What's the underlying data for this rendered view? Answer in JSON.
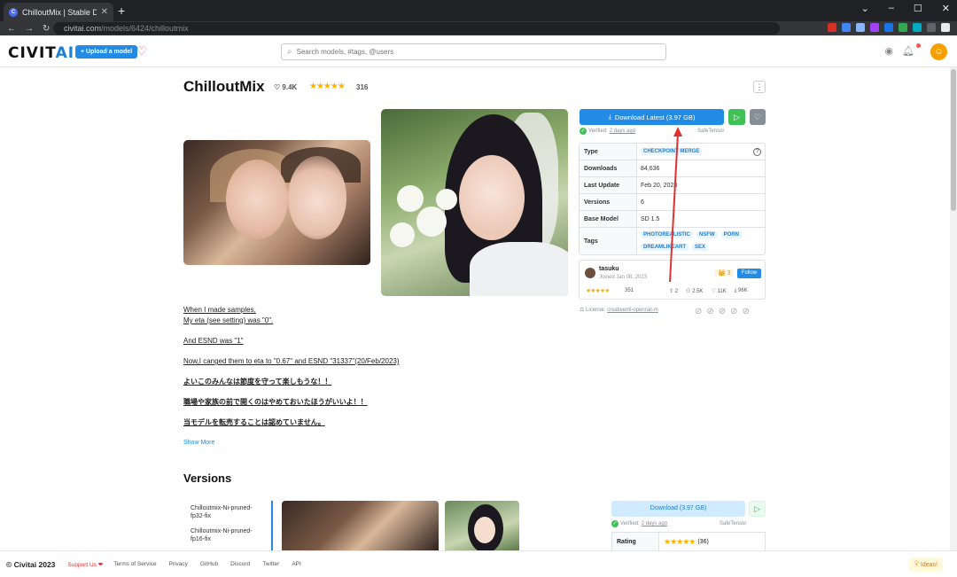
{
  "browser": {
    "tab_title": "ChilloutMix | Stable Diffusion C",
    "favicon_letter": "C",
    "url_host": "civitai.com",
    "url_path": "/models/6424/chilloutmix"
  },
  "header": {
    "logo_main": "CIVIT",
    "logo_accent": "AI",
    "upload_label": "+ Upload a model",
    "search_placeholder": "Search models, #tags, @users"
  },
  "model": {
    "title": "ChilloutMix",
    "likes": "9.4K",
    "stars": "★★★★★",
    "rating_count": "316"
  },
  "download": {
    "label": "Download Latest (3.97 GB)",
    "verified_prefix": "Verified:",
    "verified_time": "2 days ago",
    "format": "SafeTensor"
  },
  "details": {
    "rows": [
      {
        "k": "Type",
        "v": "",
        "badges": [
          "CHECKPOINT MERGE"
        ]
      },
      {
        "k": "Downloads",
        "v": "84,636"
      },
      {
        "k": "Last Update",
        "v": "Feb 20, 2023"
      },
      {
        "k": "Versions",
        "v": "6"
      },
      {
        "k": "Base Model",
        "v": "SD 1.5"
      },
      {
        "k": "Tags",
        "v": "",
        "badges": [
          "PHOTOREALISTIC",
          "NSFW",
          "PORN",
          "DREAMLIKEART",
          "SEX"
        ]
      }
    ]
  },
  "creator": {
    "name": "tasuku",
    "joined": "Joined Jan 08, 2023",
    "rank": "👑 3",
    "follow_label": "Follow",
    "stars": "★★★★★",
    "rating_count": "351",
    "uploads": "2",
    "followers": "2.5K",
    "likes": "11K",
    "downloads": "96K"
  },
  "license": {
    "prefix": "License:",
    "name": "creativeml-openrail-m"
  },
  "description": {
    "lines": [
      "When I made samples,",
      "My eta (see setting) was \"0\".",
      "And ESND was \"1\"",
      "Now,I canged them to eta to \"0.67\" and ESND \"31337\"(20/Feb/2023)",
      "よいこのみんなは節度を守って楽しもうな！！",
      "職場や家族の前で開くのはやめておいたほうがいいよ！！",
      "当モデルを転売することは認めていません。"
    ],
    "show_more": "Show More"
  },
  "versions": {
    "heading": "Versions",
    "items": [
      "Chilloutmix-Ni-pruned-fp32-fix",
      "Chilloutmix-Ni-pruned-fp16-fix"
    ],
    "download_label": "Download (3.97 GB)",
    "verified_prefix": "Verified:",
    "verified_time": "2 days ago",
    "format": "SafeTensor",
    "rating_label": "Rating",
    "rating_stars": "★★★★★",
    "rating_count": "(36)"
  },
  "footer": {
    "copyright": "© Civitai 2023",
    "support": "Support Us ❤",
    "links": [
      "Terms of Service",
      "Privacy",
      "GitHub",
      "Discord",
      "Twitter",
      "API"
    ],
    "ideas": "Ideas!"
  },
  "colors": {
    "primary": "#228be6",
    "green": "#40c057",
    "star": "#fab005",
    "annotation": "#e03131"
  }
}
